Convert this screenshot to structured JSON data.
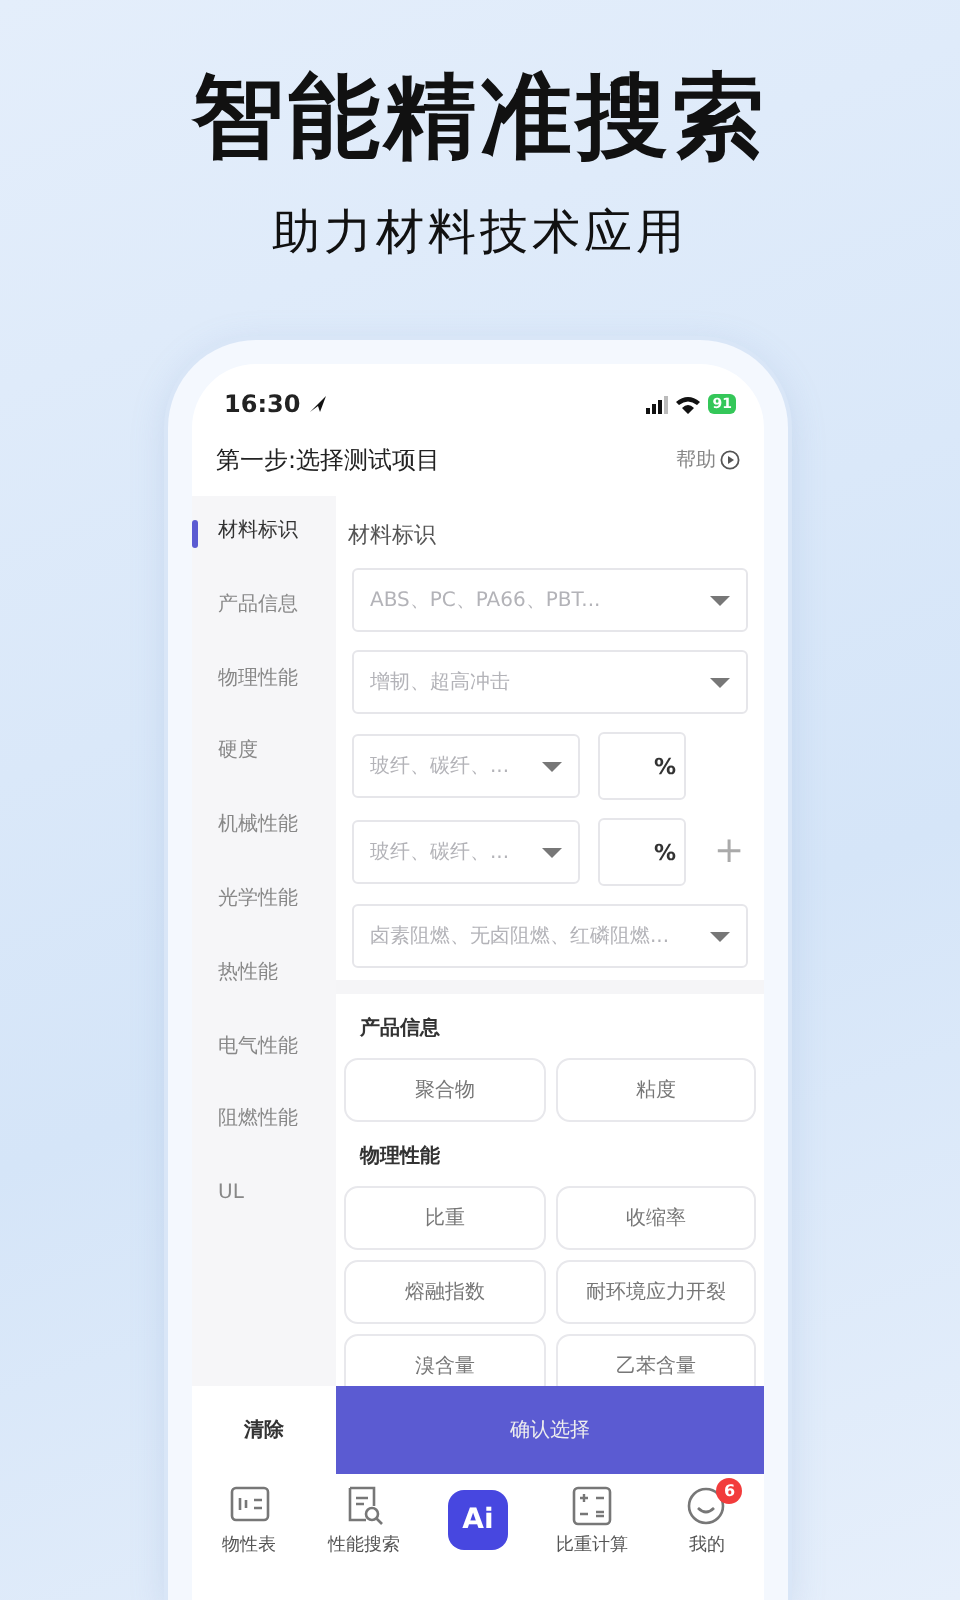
{
  "headline": "智能精准搜索",
  "subheadline": "助力材料技术应用",
  "status_bar": {
    "time": "16:30",
    "battery": "91"
  },
  "header": {
    "title": "第一步:选择测试项目",
    "help": "帮助"
  },
  "sidebar": {
    "items": [
      {
        "label": "材料标识",
        "selected": true
      },
      {
        "label": "产品信息",
        "selected": false
      },
      {
        "label": "物理性能",
        "selected": false
      },
      {
        "label": "硬度",
        "selected": false
      },
      {
        "label": "机械性能",
        "selected": false
      },
      {
        "label": "光学性能",
        "selected": false
      },
      {
        "label": "热性能",
        "selected": false
      },
      {
        "label": "电气性能",
        "selected": false
      },
      {
        "label": "阻燃性能",
        "selected": false
      },
      {
        "label": "UL",
        "selected": false
      }
    ]
  },
  "material_section": {
    "title": "材料标识",
    "fields": [
      {
        "kind": "select",
        "placeholder": "ABS、PC、PA66、PBT..."
      },
      {
        "kind": "select",
        "placeholder": "增韧、超高冲击"
      },
      {
        "kind": "filler",
        "placeholder": "玻纤、碳纤、...",
        "unit": "%"
      },
      {
        "kind": "filler",
        "placeholder": "玻纤、碳纤、...",
        "unit": "%",
        "add": "+"
      },
      {
        "kind": "select",
        "placeholder": "卤素阻燃、无卤阻燃、红磷阻燃..."
      }
    ]
  },
  "groups": [
    {
      "title": "产品信息",
      "options": [
        "聚合物",
        "粘度"
      ]
    },
    {
      "title": "物理性能",
      "options": [
        "比重",
        "收缩率",
        "熔融指数",
        "耐环境应力开裂",
        "溴含量",
        "乙苯含量"
      ]
    }
  ],
  "actions": {
    "clear": "清除",
    "confirm": "确认选择"
  },
  "tab_bar": [
    {
      "label": "物性表",
      "kind": "table"
    },
    {
      "label": "性能搜索",
      "kind": "search"
    },
    {
      "label": "Ai",
      "kind": "ai"
    },
    {
      "label": "比重计算",
      "kind": "calc"
    },
    {
      "label": "我的",
      "kind": "profile",
      "badge": "6"
    }
  ]
}
